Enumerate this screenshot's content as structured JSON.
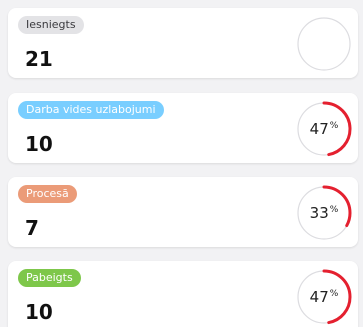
{
  "cards": [
    {
      "status": "Iesniegts",
      "count": "21",
      "percent_label": "",
      "percent": null,
      "badge_bg": "#e3e3e6",
      "badge_fg": "#3b3b3f"
    },
    {
      "status": "Darba vides uzlabojumi",
      "count": "10",
      "percent_label": "47",
      "percent": 47,
      "badge_bg": "#79ceff",
      "badge_fg": "#ffffff"
    },
    {
      "status": "Procesā",
      "count": "7",
      "percent_label": "33",
      "percent": 33,
      "badge_bg": "#eb9b78",
      "badge_fg": "#ffffff"
    },
    {
      "status": "Pabeigts",
      "count": "10",
      "percent_label": "47",
      "percent": 47,
      "badge_bg": "#7ec74a",
      "badge_fg": "#ffffff"
    }
  ],
  "percent_symbol": "%",
  "colors": {
    "ring_track": "#dcdce0",
    "ring_progress": "#e4202f"
  }
}
